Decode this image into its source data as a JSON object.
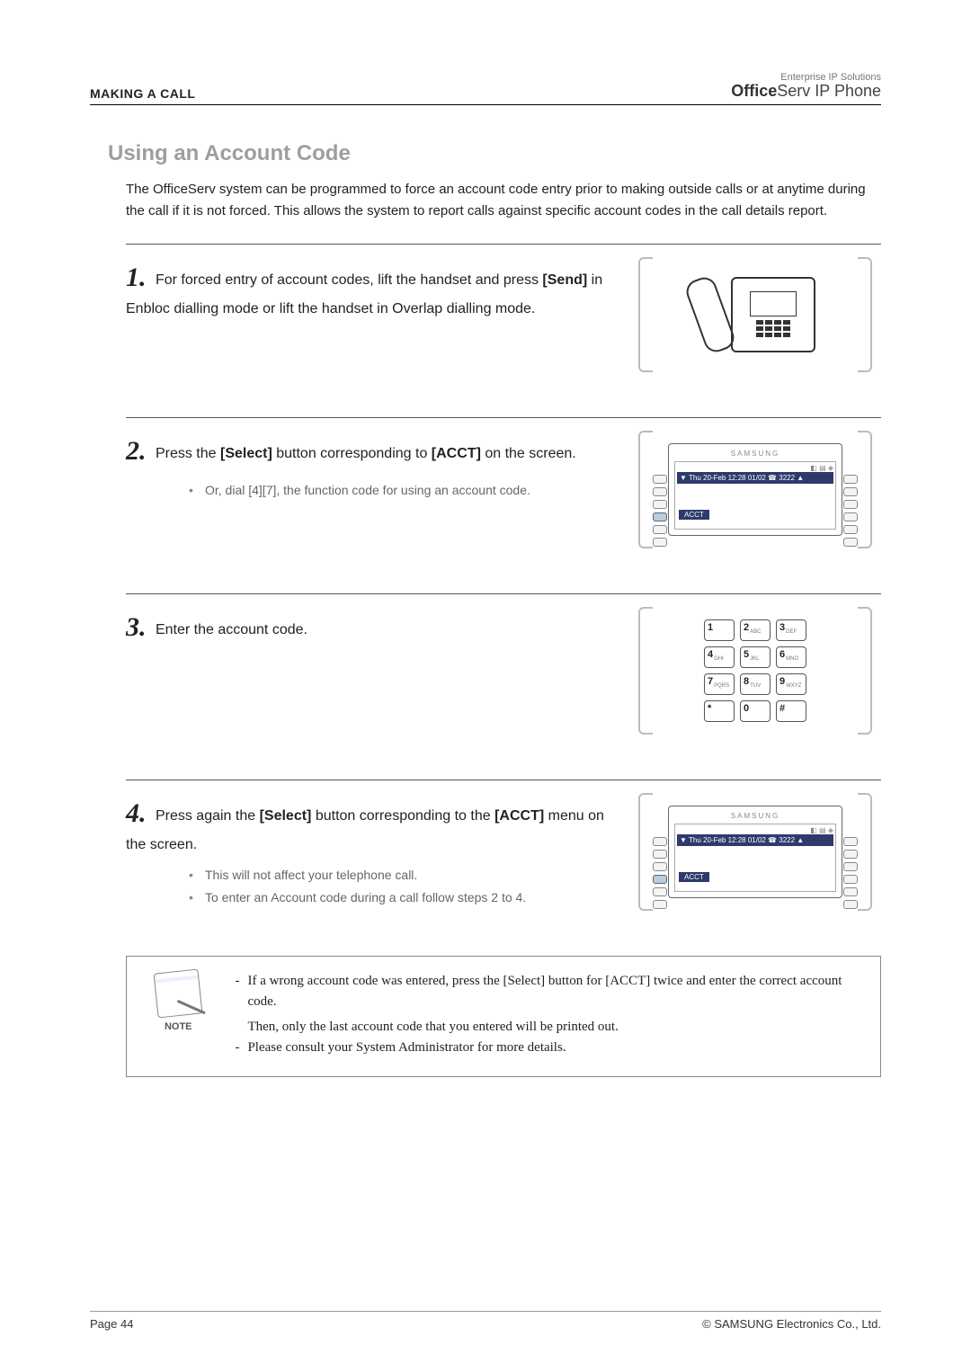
{
  "header": {
    "chapter": "MAKING A CALL",
    "brand_tagline": "Enterprise IP Solutions",
    "brand_bold": "Office",
    "brand_rest": "Serv",
    "brand_suffix": " IP Phone"
  },
  "section_title": "Using an Account Code",
  "intro": "The OfficeServ system can be programmed to force an account code entry prior to making outside calls or at anytime during the call if it is not forced. This allows the system to report calls against specific account codes in the call details report.",
  "steps": {
    "s1": {
      "num": "1.",
      "text_pre": "For forced entry of account codes, lift the handset and press ",
      "text_bold": "[Send]",
      "text_post": " in Enbloc dialling mode or lift the handset in Overlap dialling mode."
    },
    "s2": {
      "num": "2.",
      "text_pre": "Press the ",
      "text_bold1": "[Select]",
      "text_mid": " button corresponding to ",
      "text_bold2": "[ACCT]",
      "text_post": " on the screen.",
      "bullet1": "Or, dial [4][7], the function code for using an account code.",
      "screen": {
        "brand": "SAMSUNG",
        "bar": "▼ Thu 20-Feb 12:28 01/02 ☎ 3222  ▲",
        "acct": "ACCT"
      }
    },
    "s3": {
      "num": "3.",
      "text": "Enter the account code.",
      "keys": [
        "1",
        "2",
        "3",
        "4",
        "5",
        "6",
        "7",
        "8",
        "9",
        "*",
        "0",
        "#"
      ],
      "subs": [
        "",
        "ABC",
        "DEF",
        "GHI",
        "JKL",
        "MNO",
        "PQRS",
        "TUV",
        "WXYZ",
        "",
        "",
        ""
      ]
    },
    "s4": {
      "num": "4.",
      "text_pre": "Press again the ",
      "text_bold1": "[Select]",
      "text_mid": " button corresponding to the ",
      "text_bold2": "[ACCT]",
      "text_post": " menu on the screen.",
      "bullet1": "This will not affect your telephone call.",
      "bullet2": "To enter an Account code during a call follow steps 2 to 4.",
      "screen": {
        "brand": "SAMSUNG",
        "bar": "▼ Thu 20-Feb 12:28  01/02 ☎ 3222  ▲",
        "acct": "ACCT"
      }
    }
  },
  "note": {
    "label": "NOTE",
    "line1": "If a wrong account code was entered, press the [Select] button for [ACCT] twice and enter the correct account code.",
    "line1b": "Then, only the last account code that you entered will be printed out.",
    "line2": "Please consult your System Administrator for more details."
  },
  "footer": {
    "page": "Page 44",
    "copyright": "© SAMSUNG Electronics Co., Ltd."
  }
}
